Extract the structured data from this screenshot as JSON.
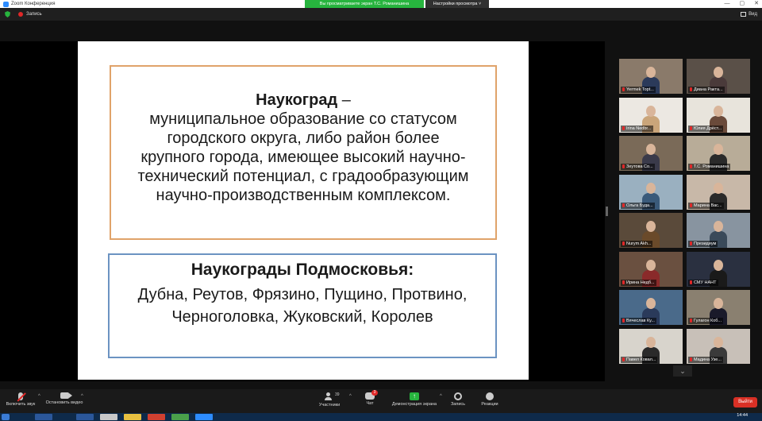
{
  "window": {
    "title": "Zoom Конференция",
    "share_banner": "Вы просматриваете экран Т.С. Романишина",
    "view_options": "Настройки просмотра ˅",
    "controls": [
      "—",
      "▢",
      "✕"
    ]
  },
  "topbar": {
    "recording_label": "Запись",
    "view_label": "Вид"
  },
  "slide": {
    "title": "Наукоград",
    "dash": " –",
    "definition_lines": [
      "муниципальное образование со статусом",
      "городского округа, либо район более",
      "крупного города, имеющее высокий научно-",
      "технический потенциал, с градообразующим",
      "научно-производственным комплексом."
    ],
    "second_heading": "Наукограды Подмосковья:",
    "cities_lines": [
      "Дубна, Реутов, Фрязино, Пущино, Протвино,",
      "Черноголовка, Жуковский, Королев"
    ]
  },
  "gallery": {
    "tiles": [
      {
        "name": "Yermek Topt...",
        "torso": "#2b3a5a",
        "bg": "#8a7a6a"
      },
      {
        "name": "Диана Ракта...",
        "torso": "#4a3a3a",
        "bg": "#5a5048"
      },
      {
        "name": "Irina Nedbr...",
        "torso": "#caa57a",
        "bg": "#ece8e2"
      },
      {
        "name": "Юлия Дрёст...",
        "torso": "#6a4a3a",
        "bg": "#e8e4dc"
      },
      {
        "name": "Зеутова Со...",
        "torso": "#3a3a4a",
        "bg": "#7a6a58"
      },
      {
        "name": "Т.С. Романишина",
        "torso": "#2a2a2a",
        "bg": "#b8ac98"
      },
      {
        "name": "Ольга Буда...",
        "torso": "#3a5a7a",
        "bg": "#9ab0c0"
      },
      {
        "name": "Марина Вас...",
        "torso": "#2a2a2a",
        "bg": "#c8b8a8"
      },
      {
        "name": "Nurym Akh...",
        "torso": "#6a4a2a",
        "bg": "#5a4a3a"
      },
      {
        "name": "Президиум",
        "torso": "#3a4a5a",
        "bg": "#8894a0"
      },
      {
        "name": "Ирина Недб...",
        "torso": "#8a2a2a",
        "bg": "#6a5040"
      },
      {
        "name": "СМУ НАНТ",
        "torso": "#1a1a1a",
        "bg": "#2a3040"
      },
      {
        "name": "Вячеслав Ку...",
        "torso": "#2a3a5a",
        "bg": "#4a6a8a"
      },
      {
        "name": "Гулагон Коб...",
        "torso": "#1a1a2a",
        "bg": "#8a8070"
      },
      {
        "name": "Павел Ковал...",
        "torso": "#2a2a2a",
        "bg": "#d8d4cc"
      },
      {
        "name": "Мадина Узе...",
        "torso": "#3a3a3a",
        "bg": "#c8c0b8"
      }
    ],
    "scroll_down": "⌄"
  },
  "toolbar": {
    "unmute_label": "Включить звук",
    "video_label": "Остановить видео",
    "participants_label": "Участники",
    "participants_count": "39",
    "chat_label": "Чат",
    "chat_badge": "3",
    "share_label": "Демонстрация экрана",
    "record_label": "Запись",
    "reactions_label": "Реакции",
    "leave_label": "Выйти",
    "caret": "^"
  },
  "taskbar": {
    "time": "14:44"
  },
  "colors": {
    "share_banner": "#27b43e",
    "leave": "#d93025",
    "active_speaker": "#9bd34b",
    "box1_border": "#e0a36a",
    "box2_border": "#6b93c2"
  }
}
